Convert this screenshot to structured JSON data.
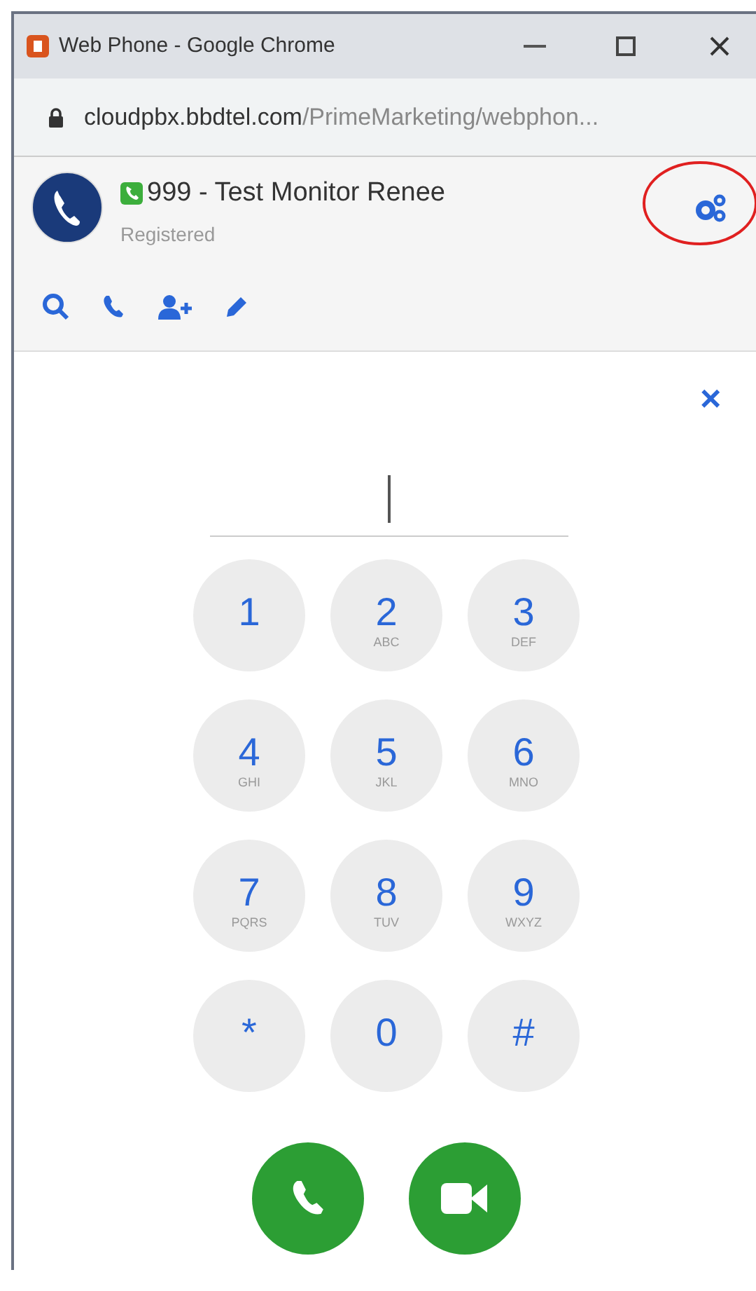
{
  "window": {
    "title": "Web Phone - Google Chrome"
  },
  "address_bar": {
    "domain": "cloudpbx.bbdtel.com",
    "path": "/PrimeMarketing/webphon..."
  },
  "account": {
    "name": "999 - Test Monitor Renee",
    "status": "Registered"
  },
  "dialpad": {
    "close": "×",
    "keys": [
      {
        "digit": "1"
      },
      {
        "digit": "2",
        "letters": "ABC"
      },
      {
        "digit": "3",
        "letters": "DEF"
      },
      {
        "digit": "4",
        "letters": "GHI"
      },
      {
        "digit": "5",
        "letters": "JKL"
      },
      {
        "digit": "6",
        "letters": "MNO"
      },
      {
        "digit": "7",
        "letters": "PQRS"
      },
      {
        "digit": "8",
        "letters": "TUV"
      },
      {
        "digit": "9",
        "letters": "WXYZ"
      },
      {
        "digit": "*"
      },
      {
        "digit": "0"
      },
      {
        "digit": "#"
      }
    ]
  }
}
